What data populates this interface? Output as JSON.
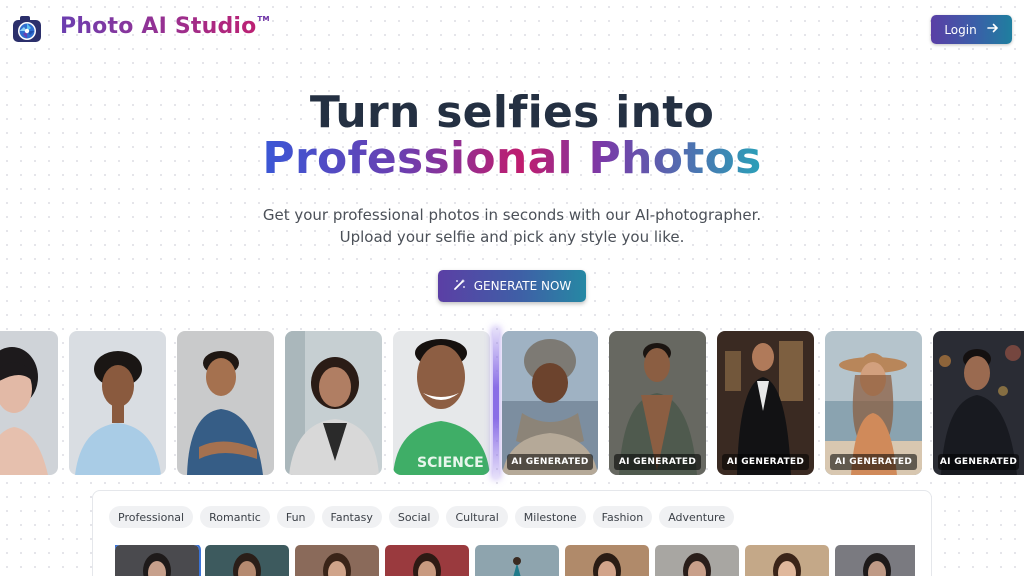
{
  "header": {
    "brand": "Photo AI Studio",
    "trademark": "TM",
    "login_label": "Login",
    "logo_icon": "camera-aperture-icon",
    "login_icon": "arrow-right-icon"
  },
  "hero": {
    "line1": "Turn selfies into",
    "line2": "Professional Photos",
    "subtitle_line1": "Get your professional photos in seconds with our AI-photographer.",
    "subtitle_line2": "Upload your selfie and pick any style you like.",
    "cta_label": "GENERATE NOW",
    "cta_icon": "magic-wand-icon"
  },
  "showcase": {
    "ai_label": "AI GENERATED",
    "selfies": [
      {
        "subject": "woman-portrait",
        "bg": "#cfd3d8"
      },
      {
        "subject": "young-man-curly-hair",
        "bg": "#d9dde2"
      },
      {
        "subject": "man-crossed-arms",
        "bg": "#c9cacb"
      },
      {
        "subject": "woman-office",
        "bg": "#c6cfd2"
      },
      {
        "subject": "man-green-shirt",
        "bg": "#e6e8ea"
      }
    ],
    "generated": [
      {
        "subject": "woman-winter-hat",
        "bg": "#7c8ea0"
      },
      {
        "subject": "man-open-shirt-street",
        "bg": "#5a5c58"
      },
      {
        "subject": "man-black-suit-interior",
        "bg": "#3a2a22"
      },
      {
        "subject": "woman-sun-hat-beach",
        "bg": "#b5c4cc"
      },
      {
        "subject": "man-city-night",
        "bg": "#2a2c34"
      }
    ]
  },
  "categories": [
    "Professional",
    "Romantic",
    "Fun",
    "Fantasy",
    "Social",
    "Cultural",
    "Milestone",
    "Fashion",
    "Adventure"
  ],
  "colors": {
    "accent_purple": "#5b3fa5",
    "accent_teal": "#2688a4",
    "heading_dark": "#243042",
    "selection_blue": "#3b74d8"
  }
}
